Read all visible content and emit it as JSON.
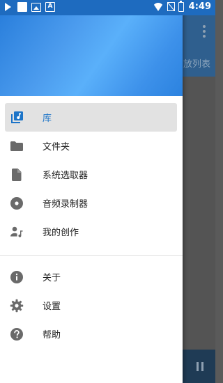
{
  "status_bar": {
    "time": "4:49",
    "left_icons": [
      "play-icon",
      "notification-square-icon",
      "image-icon",
      "font-icon"
    ],
    "right_icons": [
      "wifi-icon",
      "no-sim-icon",
      "battery-charging-icon"
    ]
  },
  "background_app": {
    "tab_label_partial": "放列表",
    "overflow_icon": "more-vert-icon",
    "pause_icon": "pause-icon"
  },
  "drawer": {
    "items_primary": [
      {
        "label": "库",
        "icon": "library-music-icon",
        "selected": true
      },
      {
        "label": "文件夹",
        "icon": "folder-icon",
        "selected": false
      },
      {
        "label": "系统选取器",
        "icon": "file-icon",
        "selected": false
      },
      {
        "label": "音频录制器",
        "icon": "disc-icon",
        "selected": false
      },
      {
        "label": "我的创作",
        "icon": "person-music-icon",
        "selected": false
      }
    ],
    "items_secondary": [
      {
        "label": "关于",
        "icon": "info-icon"
      },
      {
        "label": "设置",
        "icon": "settings-gear-icon"
      },
      {
        "label": "帮助",
        "icon": "help-icon"
      }
    ]
  },
  "colors": {
    "accent": "#1c74c8",
    "status_bar": "#1e6bbf",
    "icon_grey": "#6a6a6a",
    "selected_bg": "#e2e2e2"
  }
}
